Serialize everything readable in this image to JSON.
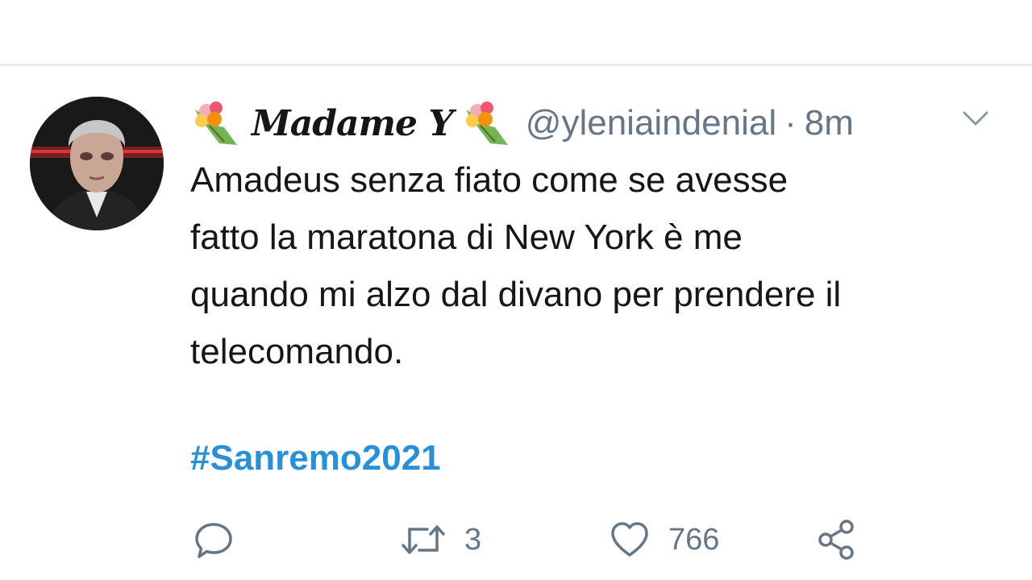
{
  "tweet": {
    "display_name": "Madame Y",
    "handle": "@yleniaindenial",
    "separator": "·",
    "time": "8m",
    "text": "Amadeus senza fiato come se avesse\nfatto la maratona di New York è me\nquando mi alzo dal divano per prendere il\ntelecomando.",
    "hashtag": "#Sanremo2021",
    "name_emoji_icon": "bouquet-icon",
    "menu_icon": "chevron-down-icon"
  },
  "actions": {
    "reply": {
      "icon": "reply-icon"
    },
    "retweet": {
      "icon": "retweet-icon",
      "count": "3"
    },
    "like": {
      "icon": "heart-icon",
      "count": "766"
    },
    "share": {
      "icon": "share-icon"
    }
  },
  "colors": {
    "text": "#14171a",
    "secondary": "#657786",
    "hashtag": "#2b8fd6",
    "divider": "#e6ecf0"
  }
}
